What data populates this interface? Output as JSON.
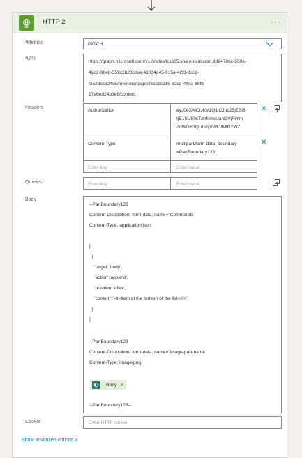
{
  "header": {
    "title": "HTTP 2",
    "more_label": "···"
  },
  "method": {
    "label": "Method",
    "required": "*",
    "value": "PATCH"
  },
  "uri": {
    "label": "URI",
    "required": "*",
    "lines": [
      "https://graph.microsoft.com/v1.0/sites/bp365.sharepoint.com,9d94786c-650e-",
      "42d2-98eb-559c2b23cbce,41034d45-915a-42f3-8cc2-",
      "f352dcca24c5/onenote/pages/5bc1c916-e2cd-44ca-88f8-",
      "17a6ed24b3e6/content"
    ]
  },
  "headers": {
    "label": "Headers",
    "rows": [
      {
        "key": "Authorization",
        "value_lines": [
          "eyJ0eXAiOiJKV1QiLCJub25jZSI6",
          "IjE1SU50cTdnNmxUanl2VjRiYm",
          "ZnWDY3QUI5bjVWLVMtR2YtZ"
        ]
      },
      {
        "key": "Content-Type",
        "value_lines": [
          "multipart/form-data; boundary",
          "=PartBoundary123"
        ]
      }
    ],
    "key_placeholder": "Enter key",
    "value_placeholder": "Enter value"
  },
  "queries": {
    "label": "Queries",
    "key_placeholder": "Enter key",
    "value_placeholder": "Enter value"
  },
  "body": {
    "label": "Body",
    "lines": [
      "--PartBoundary123",
      "Content-Disposition: form-data; name=\"Commands\"",
      "Content-Type: application/json",
      "",
      "[",
      "  {",
      "    'target':'body',",
      "    'action':'append',",
      "    'position':'after',",
      "    'content':'<li>Item at the bottom of the list</li>'",
      "  }",
      "]",
      "",
      "--PartBoundary123",
      "Content-Disposition: form-data; name=\"image-part-name\"",
      "Content-Type: image/png"
    ],
    "token": {
      "label": "Body",
      "remove": "×"
    },
    "end_line": "--PartBoundary123--"
  },
  "cookie": {
    "label": "Cookie",
    "placeholder": "Enter HTTP cookie"
  },
  "advanced": {
    "label": "Show advanced options ∨"
  },
  "colors": {
    "accent": "#0078d4",
    "header_bg": "#e8f1e2",
    "icon_green": "#5a9e2f",
    "token_bg": "#e3edd7",
    "required": "#a4262c"
  }
}
